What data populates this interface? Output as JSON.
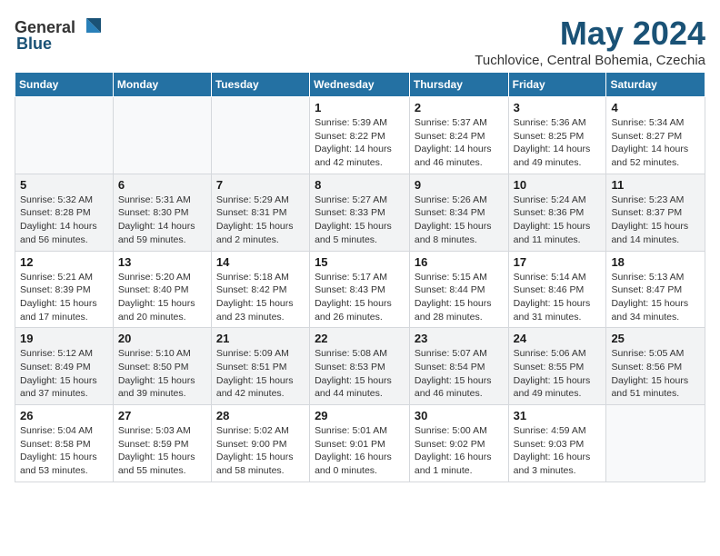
{
  "logo": {
    "general": "General",
    "blue": "Blue"
  },
  "title": {
    "month_year": "May 2024",
    "location": "Tuchlovice, Central Bohemia, Czechia"
  },
  "weekdays": [
    "Sunday",
    "Monday",
    "Tuesday",
    "Wednesday",
    "Thursday",
    "Friday",
    "Saturday"
  ],
  "weeks": [
    [
      {
        "day": "",
        "info": ""
      },
      {
        "day": "",
        "info": ""
      },
      {
        "day": "",
        "info": ""
      },
      {
        "day": "1",
        "info": "Sunrise: 5:39 AM\nSunset: 8:22 PM\nDaylight: 14 hours\nand 42 minutes."
      },
      {
        "day": "2",
        "info": "Sunrise: 5:37 AM\nSunset: 8:24 PM\nDaylight: 14 hours\nand 46 minutes."
      },
      {
        "day": "3",
        "info": "Sunrise: 5:36 AM\nSunset: 8:25 PM\nDaylight: 14 hours\nand 49 minutes."
      },
      {
        "day": "4",
        "info": "Sunrise: 5:34 AM\nSunset: 8:27 PM\nDaylight: 14 hours\nand 52 minutes."
      }
    ],
    [
      {
        "day": "5",
        "info": "Sunrise: 5:32 AM\nSunset: 8:28 PM\nDaylight: 14 hours\nand 56 minutes."
      },
      {
        "day": "6",
        "info": "Sunrise: 5:31 AM\nSunset: 8:30 PM\nDaylight: 14 hours\nand 59 minutes."
      },
      {
        "day": "7",
        "info": "Sunrise: 5:29 AM\nSunset: 8:31 PM\nDaylight: 15 hours\nand 2 minutes."
      },
      {
        "day": "8",
        "info": "Sunrise: 5:27 AM\nSunset: 8:33 PM\nDaylight: 15 hours\nand 5 minutes."
      },
      {
        "day": "9",
        "info": "Sunrise: 5:26 AM\nSunset: 8:34 PM\nDaylight: 15 hours\nand 8 minutes."
      },
      {
        "day": "10",
        "info": "Sunrise: 5:24 AM\nSunset: 8:36 PM\nDaylight: 15 hours\nand 11 minutes."
      },
      {
        "day": "11",
        "info": "Sunrise: 5:23 AM\nSunset: 8:37 PM\nDaylight: 15 hours\nand 14 minutes."
      }
    ],
    [
      {
        "day": "12",
        "info": "Sunrise: 5:21 AM\nSunset: 8:39 PM\nDaylight: 15 hours\nand 17 minutes."
      },
      {
        "day": "13",
        "info": "Sunrise: 5:20 AM\nSunset: 8:40 PM\nDaylight: 15 hours\nand 20 minutes."
      },
      {
        "day": "14",
        "info": "Sunrise: 5:18 AM\nSunset: 8:42 PM\nDaylight: 15 hours\nand 23 minutes."
      },
      {
        "day": "15",
        "info": "Sunrise: 5:17 AM\nSunset: 8:43 PM\nDaylight: 15 hours\nand 26 minutes."
      },
      {
        "day": "16",
        "info": "Sunrise: 5:15 AM\nSunset: 8:44 PM\nDaylight: 15 hours\nand 28 minutes."
      },
      {
        "day": "17",
        "info": "Sunrise: 5:14 AM\nSunset: 8:46 PM\nDaylight: 15 hours\nand 31 minutes."
      },
      {
        "day": "18",
        "info": "Sunrise: 5:13 AM\nSunset: 8:47 PM\nDaylight: 15 hours\nand 34 minutes."
      }
    ],
    [
      {
        "day": "19",
        "info": "Sunrise: 5:12 AM\nSunset: 8:49 PM\nDaylight: 15 hours\nand 37 minutes."
      },
      {
        "day": "20",
        "info": "Sunrise: 5:10 AM\nSunset: 8:50 PM\nDaylight: 15 hours\nand 39 minutes."
      },
      {
        "day": "21",
        "info": "Sunrise: 5:09 AM\nSunset: 8:51 PM\nDaylight: 15 hours\nand 42 minutes."
      },
      {
        "day": "22",
        "info": "Sunrise: 5:08 AM\nSunset: 8:53 PM\nDaylight: 15 hours\nand 44 minutes."
      },
      {
        "day": "23",
        "info": "Sunrise: 5:07 AM\nSunset: 8:54 PM\nDaylight: 15 hours\nand 46 minutes."
      },
      {
        "day": "24",
        "info": "Sunrise: 5:06 AM\nSunset: 8:55 PM\nDaylight: 15 hours\nand 49 minutes."
      },
      {
        "day": "25",
        "info": "Sunrise: 5:05 AM\nSunset: 8:56 PM\nDaylight: 15 hours\nand 51 minutes."
      }
    ],
    [
      {
        "day": "26",
        "info": "Sunrise: 5:04 AM\nSunset: 8:58 PM\nDaylight: 15 hours\nand 53 minutes."
      },
      {
        "day": "27",
        "info": "Sunrise: 5:03 AM\nSunset: 8:59 PM\nDaylight: 15 hours\nand 55 minutes."
      },
      {
        "day": "28",
        "info": "Sunrise: 5:02 AM\nSunset: 9:00 PM\nDaylight: 15 hours\nand 58 minutes."
      },
      {
        "day": "29",
        "info": "Sunrise: 5:01 AM\nSunset: 9:01 PM\nDaylight: 16 hours\nand 0 minutes."
      },
      {
        "day": "30",
        "info": "Sunrise: 5:00 AM\nSunset: 9:02 PM\nDaylight: 16 hours\nand 1 minute."
      },
      {
        "day": "31",
        "info": "Sunrise: 4:59 AM\nSunset: 9:03 PM\nDaylight: 16 hours\nand 3 minutes."
      },
      {
        "day": "",
        "info": ""
      }
    ]
  ]
}
